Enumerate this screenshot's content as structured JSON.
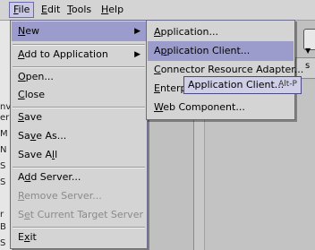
{
  "menubar": {
    "items": [
      {
        "pre": "",
        "mn": "F",
        "post": "ile"
      },
      {
        "pre": "",
        "mn": "E",
        "post": "dit"
      },
      {
        "pre": "",
        "mn": "T",
        "post": "ools"
      },
      {
        "pre": "",
        "mn": "H",
        "post": "elp"
      }
    ]
  },
  "left_fragments": [
    "nv",
    "er",
    "M",
    "N",
    "S",
    "S",
    "r",
    "B",
    "S"
  ],
  "right_tab_label": "s",
  "file_menu": {
    "new": {
      "pre": "",
      "mn": "N",
      "post": "ew"
    },
    "add_to_application": {
      "pre": "",
      "mn": "A",
      "post": "dd to Application"
    },
    "open": {
      "pre": "",
      "mn": "O",
      "post": "pen..."
    },
    "close": {
      "pre": "",
      "mn": "C",
      "post": "lose"
    },
    "save": {
      "pre": "",
      "mn": "S",
      "post": "ave"
    },
    "save_as": {
      "pre": "Sa",
      "mn": "v",
      "post": "e As..."
    },
    "save_all": {
      "pre": "Save A",
      "mn": "l",
      "post": "l"
    },
    "add_server": {
      "pre": "A",
      "mn": "d",
      "post": "d Server..."
    },
    "remove_server": {
      "pre": "",
      "mn": "R",
      "post": "emove Server..."
    },
    "set_target_server": {
      "pre": "S",
      "mn": "e",
      "post": "t Current Target Server"
    },
    "exit": {
      "pre": "E",
      "mn": "x",
      "post": "it"
    }
  },
  "new_menu": {
    "application": {
      "pre": "",
      "mn": "A",
      "post": "pplication..."
    },
    "application_client": {
      "pre": "A",
      "mn": "p",
      "post": "plication Client..."
    },
    "connector": {
      "pre": "",
      "mn": "C",
      "post": "onnector Resource Adapter..."
    },
    "enterprise": {
      "pre": "",
      "mn": "E",
      "post": "nterpr"
    },
    "web_component": {
      "pre": "",
      "mn": "W",
      "post": "eb Component..."
    }
  },
  "tooltip": {
    "label": "Application Client...",
    "shortcut": "Alt-P"
  },
  "colors": {
    "highlight": "#9c9ccc",
    "menu_bg": "#d4d4d4",
    "disabled": "#8a8a8a"
  }
}
